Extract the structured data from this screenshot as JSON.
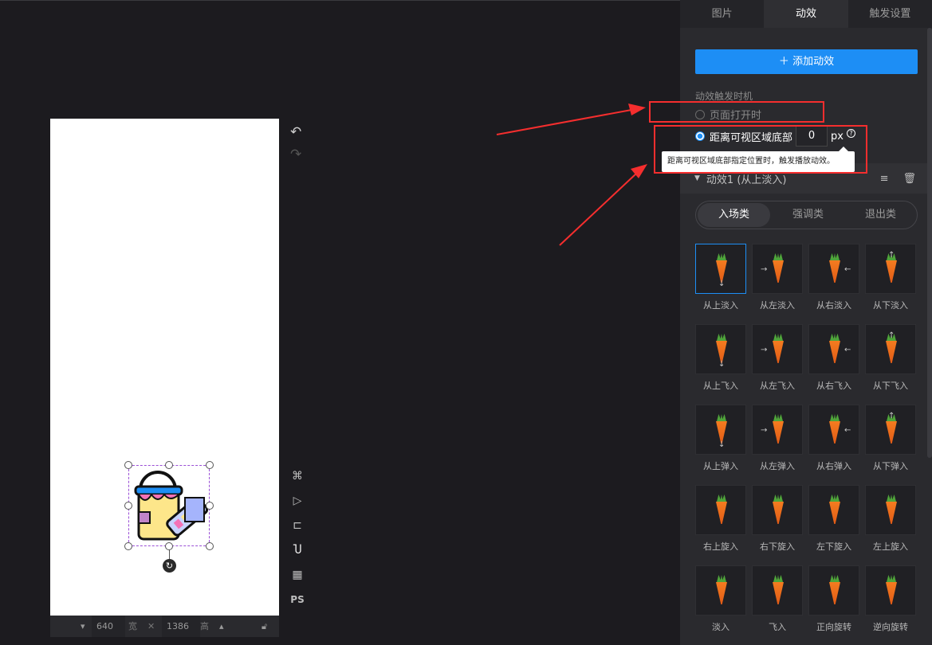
{
  "panel": {
    "tabs": [
      "图片",
      "动效",
      "触发设置"
    ],
    "add_button": "添加动效",
    "trigger_label": "动效触发时机",
    "option_page_open": "页面打开时",
    "option_distance": "距离可视区域底部",
    "distance_value": "0",
    "distance_unit": "px",
    "tooltip": "距离可视区域底部指定位置时，触发播放动效。",
    "anim_title": "动效1 (从上淡入)",
    "segments": [
      "入场类",
      "强调类",
      "退出类"
    ],
    "effects": [
      "从上淡入",
      "从左淡入",
      "从右淡入",
      "从下淡入",
      "从上飞入",
      "从左飞入",
      "从右飞入",
      "从下飞入",
      "从上弹入",
      "从左弹入",
      "从右弹入",
      "从下弹入",
      "右上旋入",
      "右下旋入",
      "左下旋入",
      "左上旋入",
      "淡入",
      "飞入",
      "正向旋转",
      "逆向旋转"
    ]
  },
  "canvas": {
    "width": "640",
    "width_label": "宽",
    "height": "1386",
    "height_label": "高"
  },
  "colors": {
    "accent": "#1d8ef5",
    "highlight": "#f52e2e"
  }
}
